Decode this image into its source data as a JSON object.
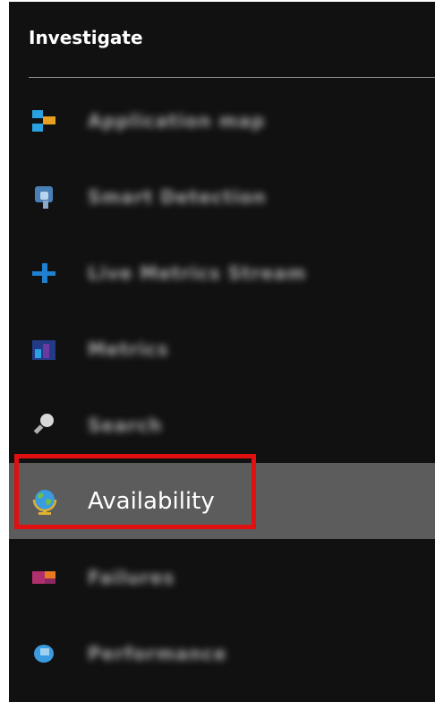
{
  "section": {
    "title": "Investigate"
  },
  "menu": {
    "items": [
      {
        "label": "Application map",
        "icon": "application-map-icon",
        "blurred": true
      },
      {
        "label": "Smart Detection",
        "icon": "smart-detection-icon",
        "blurred": true
      },
      {
        "label": "Live Metrics Stream",
        "icon": "live-metrics-icon",
        "blurred": true
      },
      {
        "label": "Metrics",
        "icon": "metrics-icon",
        "blurred": true
      },
      {
        "label": "Search",
        "icon": "search-icon",
        "blurred": true
      },
      {
        "label": "Availability",
        "icon": "globe-icon",
        "blurred": false,
        "selected": true
      },
      {
        "label": "Failures",
        "icon": "failures-icon",
        "blurred": true
      },
      {
        "label": "Performance",
        "icon": "performance-icon",
        "blurred": true
      }
    ]
  },
  "colors": {
    "panel_bg": "#111111",
    "selected_bg": "#5c5c5c",
    "highlight_border": "#e01010"
  }
}
